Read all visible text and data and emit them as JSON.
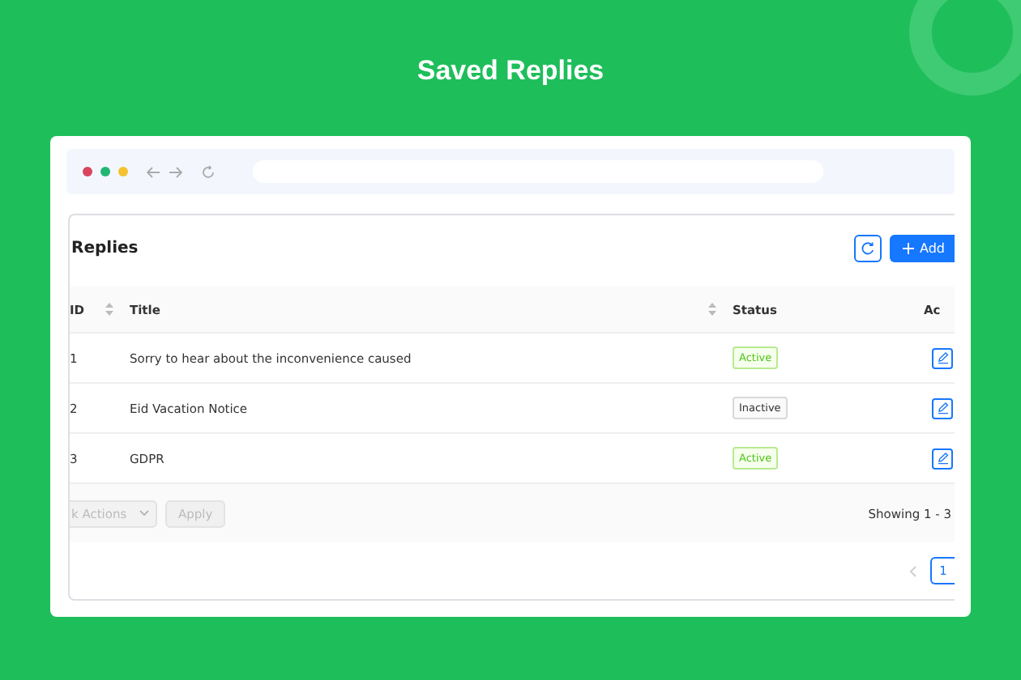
{
  "page_title": "Saved Replies",
  "panel": {
    "title": "Replies",
    "add_button": "Add"
  },
  "table": {
    "columns": [
      {
        "label": "ID",
        "sortable": true
      },
      {
        "label": "Title",
        "sortable": true
      },
      {
        "label": "Status",
        "sortable": false
      },
      {
        "label": "Ac",
        "sortable": false
      }
    ],
    "rows": [
      {
        "id": "1",
        "title": "Sorry to hear about the inconvenience caused",
        "status": "Active",
        "active": true
      },
      {
        "id": "2",
        "title": "Eid Vacation Notice",
        "status": "Inactive",
        "active": false
      },
      {
        "id": "3",
        "title": "GDPR",
        "status": "Active",
        "active": true
      }
    ]
  },
  "footer": {
    "bulk_actions": "k Actions",
    "apply": "Apply",
    "showing": "Showing 1 - 3"
  },
  "pagination": {
    "pages": [
      {
        "label": "1",
        "selected": true
      }
    ]
  }
}
